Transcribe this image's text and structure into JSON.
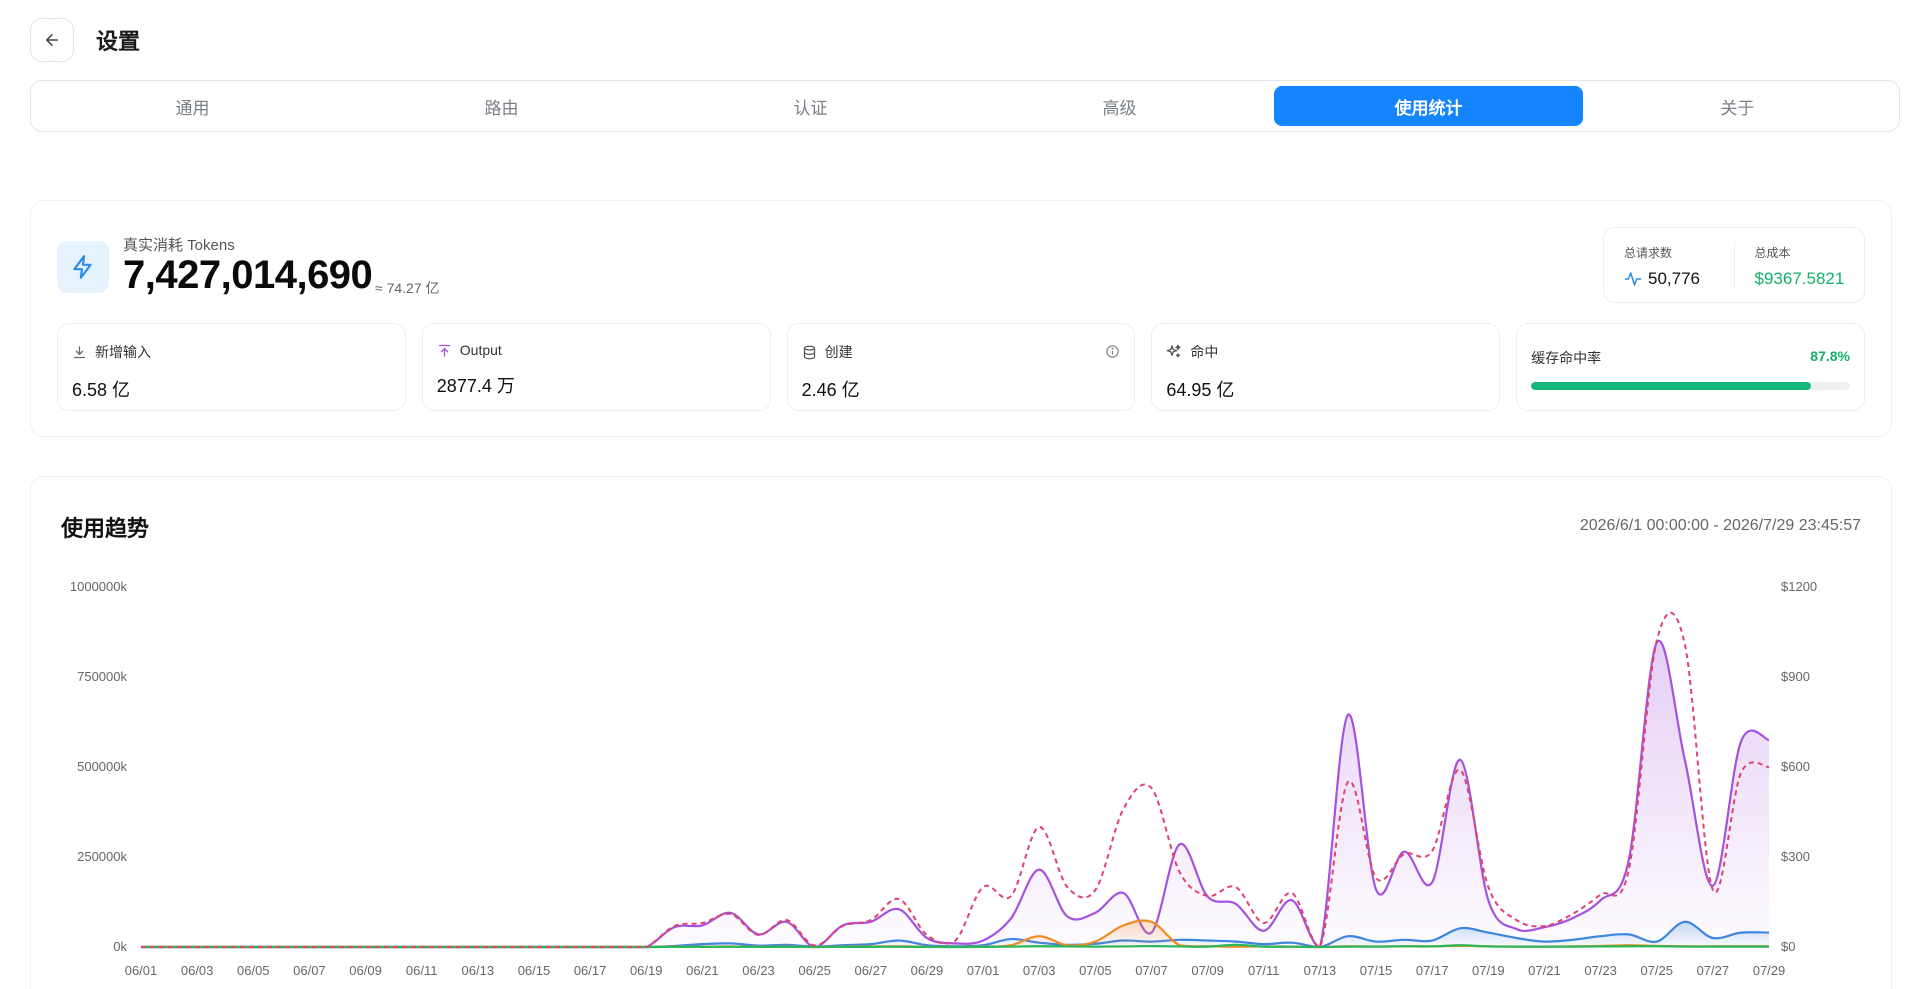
{
  "header": {
    "title": "设置"
  },
  "tabs": [
    {
      "label": "通用",
      "active": false
    },
    {
      "label": "路由",
      "active": false
    },
    {
      "label": "认证",
      "active": false
    },
    {
      "label": "高级",
      "active": false
    },
    {
      "label": "使用统计",
      "active": true
    },
    {
      "label": "关于",
      "active": false
    }
  ],
  "summary": {
    "tokens_label": "真实消耗 Tokens",
    "tokens_value": "7,427,014,690",
    "tokens_approx": "≈ 74.27 亿",
    "total_requests_label": "总请求数",
    "total_requests_value": "50,776",
    "total_cost_label": "总成本",
    "total_cost_value": "$9367.5821",
    "stats": [
      {
        "label": "新增输入",
        "value": "6.58 亿",
        "icon": "download-icon"
      },
      {
        "label": "Output",
        "value": "2877.4 万",
        "icon": "upload-icon"
      },
      {
        "label": "创建",
        "value": "2.46 亿",
        "icon": "database-icon"
      },
      {
        "label": "命中",
        "value": "64.95 亿",
        "icon": "sparkle-icon"
      }
    ],
    "cache_hit_label": "缓存命中率",
    "cache_hit_value": "87.8%",
    "cache_hit_fraction": 0.878
  },
  "trend": {
    "title": "使用趋势",
    "range": "2026/6/1 00:00:00 - 2026/7/29 23:45:57"
  },
  "colors": {
    "accent": "#1584ff",
    "success": "#14b87a",
    "purple": "#a552de",
    "blue": "#3e86de",
    "orange": "#f08a24",
    "green": "#2bb657",
    "cost_dash": "#e0436b"
  },
  "chart_data": {
    "type": "line",
    "x": [
      "06/01",
      "06/02",
      "06/03",
      "06/04",
      "06/05",
      "06/06",
      "06/07",
      "06/08",
      "06/09",
      "06/10",
      "06/11",
      "06/12",
      "06/13",
      "06/14",
      "06/15",
      "06/16",
      "06/17",
      "06/18",
      "06/19",
      "06/20",
      "06/21",
      "06/22",
      "06/23",
      "06/24",
      "06/25",
      "06/26",
      "06/27",
      "06/28",
      "06/29",
      "06/30",
      "07/01",
      "07/02",
      "07/03",
      "07/04",
      "07/05",
      "07/06",
      "07/07",
      "07/08",
      "07/09",
      "07/10",
      "07/11",
      "07/12",
      "07/13",
      "07/14",
      "07/15",
      "07/16",
      "07/17",
      "07/18",
      "07/19",
      "07/20",
      "07/21",
      "07/22",
      "07/23",
      "07/24",
      "07/25",
      "07/26",
      "07/27",
      "07/28",
      "07/29"
    ],
    "x_tick_labels": [
      "06/01",
      "06/03",
      "06/05",
      "06/07",
      "06/09",
      "06/11",
      "06/13",
      "06/15",
      "06/17",
      "06/19",
      "06/21",
      "06/23",
      "06/25",
      "06/27",
      "06/29",
      "07/01",
      "07/03",
      "07/05",
      "07/07",
      "07/09",
      "07/11",
      "07/13",
      "07/15",
      "07/17",
      "07/19",
      "07/21",
      "07/23",
      "07/25",
      "07/27",
      "07/29"
    ],
    "y_left_ticks": [
      "0k",
      "250000k",
      "500000k",
      "750000k",
      "1000000k"
    ],
    "y_left_range": [
      0,
      1000000
    ],
    "y_right_ticks": [
      "$0",
      "$300",
      "$600",
      "$900",
      "$1200"
    ],
    "y_right_range": [
      0,
      1200
    ],
    "grid": false,
    "series": [
      {
        "axis": "left",
        "color": "#a552de",
        "fill": true,
        "values": [
          0,
          0,
          0,
          0,
          0,
          0,
          0,
          0,
          0,
          0,
          0,
          0,
          0,
          0,
          0,
          0,
          0,
          0,
          0,
          55000,
          60000,
          95000,
          35000,
          70000,
          0,
          60000,
          70000,
          105000,
          25000,
          10000,
          18000,
          80000,
          215000,
          85000,
          95000,
          150000,
          40000,
          285000,
          140000,
          120000,
          45000,
          130000,
          0,
          645000,
          160000,
          265000,
          180000,
          520000,
          130000,
          50000,
          55000,
          80000,
          130000,
          240000,
          845000,
          520000,
          170000,
          570000,
          575000
        ]
      },
      {
        "axis": "left",
        "color": "#3e86de",
        "fill": true,
        "values": [
          0,
          0,
          0,
          0,
          0,
          0,
          0,
          0,
          0,
          0,
          0,
          0,
          0,
          0,
          0,
          0,
          0,
          0,
          0,
          3000,
          8000,
          10000,
          4000,
          6000,
          1000,
          5000,
          8000,
          18000,
          5000,
          2000,
          5000,
          22000,
          12000,
          6000,
          9000,
          18000,
          15000,
          20000,
          18000,
          15000,
          8000,
          12000,
          0,
          30000,
          15000,
          20000,
          18000,
          52000,
          40000,
          25000,
          15000,
          20000,
          30000,
          35000,
          15000,
          70000,
          25000,
          40000,
          40000
        ]
      },
      {
        "axis": "left",
        "color": "#f08a24",
        "fill": true,
        "values": [
          0,
          0,
          0,
          0,
          0,
          0,
          0,
          0,
          0,
          0,
          0,
          0,
          0,
          0,
          0,
          0,
          0,
          0,
          0,
          500,
          1000,
          1500,
          500,
          1000,
          0,
          1000,
          1500,
          2000,
          500,
          200,
          1000,
          5000,
          30000,
          5000,
          15000,
          60000,
          70000,
          5000,
          2000,
          1000,
          1500,
          1000,
          0,
          2000,
          1500,
          2000,
          2000,
          3000,
          2000,
          1000,
          1000,
          2000,
          3000,
          5000,
          3000,
          2000,
          2000,
          2000,
          2000
        ]
      },
      {
        "axis": "left",
        "color": "#2bb657",
        "fill": false,
        "values": [
          0,
          0,
          0,
          0,
          0,
          0,
          0,
          0,
          0,
          0,
          0,
          0,
          0,
          0,
          0,
          0,
          0,
          0,
          0,
          200,
          400,
          500,
          200,
          300,
          0,
          300,
          400,
          600,
          200,
          100,
          300,
          1000,
          2000,
          1500,
          1000,
          1500,
          2500,
          1500,
          1000,
          6000,
          1000,
          800,
          0,
          1000,
          1000,
          2000,
          1500,
          5000,
          1500,
          1000,
          800,
          1000,
          1500,
          2000,
          2000,
          1000,
          1000,
          1000,
          1000
        ]
      },
      {
        "axis": "right",
        "color": "#e0436b",
        "dashed": true,
        "values": [
          0,
          0,
          0,
          0,
          0,
          0,
          0,
          0,
          0,
          0,
          0,
          0,
          0,
          0,
          0,
          0,
          0,
          0,
          0,
          70,
          80,
          110,
          40,
          90,
          5,
          70,
          90,
          160,
          40,
          20,
          200,
          170,
          400,
          200,
          190,
          460,
          530,
          250,
          170,
          200,
          80,
          180,
          0,
          550,
          230,
          310,
          320,
          590,
          200,
          90,
          70,
          110,
          175,
          255,
          1020,
          1010,
          190,
          580,
          600
        ]
      }
    ]
  }
}
